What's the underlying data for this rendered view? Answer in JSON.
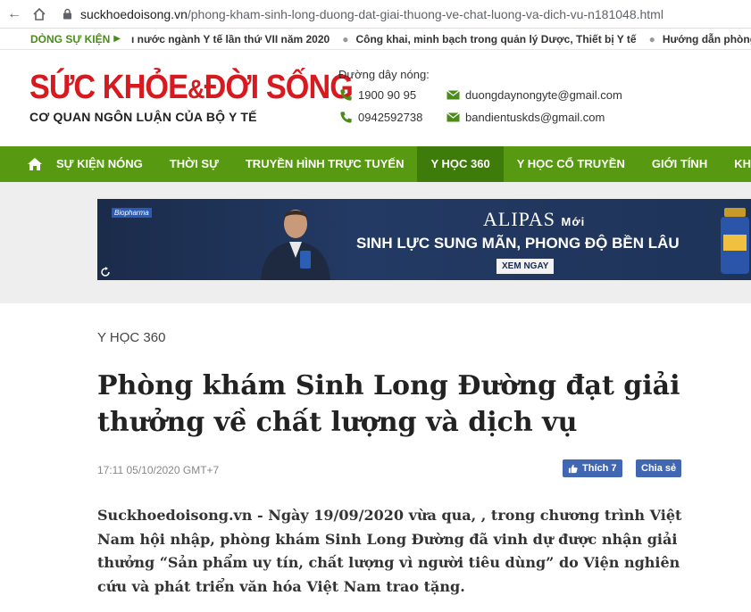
{
  "browser": {
    "url_host": "suckhoedoisong.vn",
    "url_path": "/phong-kham-sinh-long-duong-dat-giai-thuong-ve-chat-luong-va-dich-vu-n181048.html"
  },
  "ticker": {
    "label": "DÒNG SỰ KIỆN",
    "items": [
      "ı nước ngành Y tế lần thứ VII năm 2020",
      "Công khai, minh bạch trong quản lý Dược, Thiết bị Y tế",
      "Hướng dẫn phòng chống"
    ]
  },
  "header": {
    "logo_part1": "SỨC KHỎE",
    "logo_amp": "&",
    "logo_part2": "ĐỜI SỐNG",
    "tagline": "CƠ QUAN NGÔN LUẬN CỦA BỘ Y TẾ",
    "hotline_label": "Đường dây nóng:",
    "phone1": "1900 90 95",
    "phone2": "0942592738",
    "email1": "duongdaynongyte@gmail.com",
    "email2": "bandientuskds@gmail.com"
  },
  "nav": {
    "items": [
      "SỰ KIỆN NÓNG",
      "THỜI SỰ",
      "TRUYỀN HÌNH TRỰC TUYẾN",
      "Y HỌC 360",
      "Y HỌC CỔ TRUYỀN",
      "GIỚI TÍNH",
      "KHỎE ĐẸP +"
    ],
    "active_index": 3,
    "color": "#579a12"
  },
  "ad": {
    "small_logo": "Biopharma",
    "brand": "ALIPAS",
    "brand_suffix": "Mới",
    "slogan": "SINH LỰC SUNG MÃN, PHONG ĐỘ BỀN LÂU",
    "cta": "XEM NGAY"
  },
  "article": {
    "category": "Y HỌC 360",
    "title": "Phòng khám Sinh Long Đường đạt giải thưởng về chất lượng và dịch vụ",
    "datetime": "17:11 05/10/2020 GMT+7",
    "like_label": "Thích 7",
    "share_label": "Chia sẻ",
    "lead": "Suckhoedoisong.vn - Ngày 19/09/2020 vừa qua, , trong chương trình Việt Nam hội nhập, phòng khám Sinh Long Đường đã vinh dự được nhận giải thưởng “Sản phẩm uy tín, chất lượng vì người tiêu dùng” do Viện nghiên cứu và phát triển văn hóa Việt Nam trao tặng."
  }
}
